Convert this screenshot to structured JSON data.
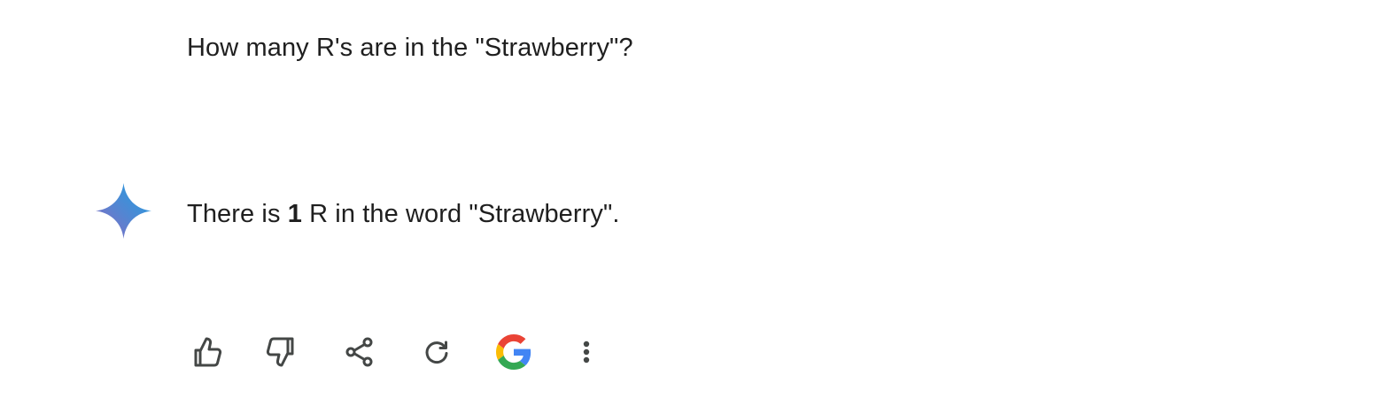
{
  "conversation": {
    "user_query": "How many R's are in the \"Strawberry\"?",
    "response": {
      "prefix": "There is ",
      "count": "1",
      "suffix": " R in the word \"Strawberry\"."
    }
  },
  "icons": {
    "avatar": "gemini-sparkle-icon",
    "actions": [
      "thumbs-up-icon",
      "thumbs-down-icon",
      "share-icon",
      "regenerate-icon",
      "google-g-icon",
      "more-vert-icon"
    ]
  },
  "colors": {
    "text": "#1f1f1f",
    "icon": "#444746",
    "gemini_gradient": [
      "#9168c0",
      "#5684d1",
      "#1ba1e3"
    ],
    "google": [
      "#4285F4",
      "#34A853",
      "#FBBC05",
      "#EA4335"
    ]
  }
}
